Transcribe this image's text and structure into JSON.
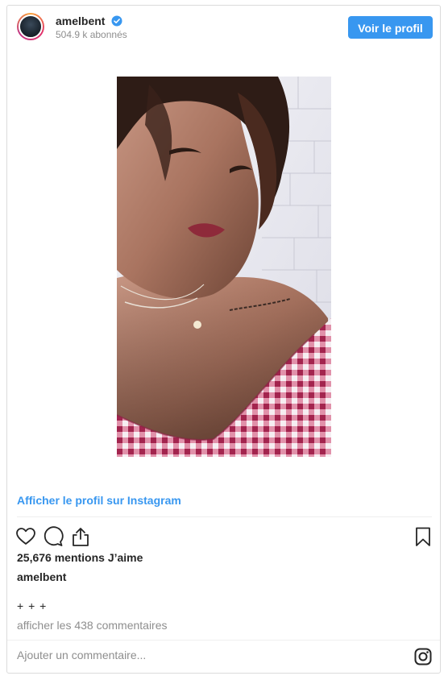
{
  "header": {
    "username": "amelbent",
    "followers": "504.9 k abonnés",
    "profile_button": "Voir le profil"
  },
  "post": {
    "view_profile_link": "Afficher le profil sur Instagram",
    "likes": "25,676 mentions J’aime",
    "owner": "amelbent",
    "caption": "+ + +",
    "view_comments": "afficher les 438 commentaires",
    "comment_placeholder": "Ajouter un commentaire..."
  },
  "icons": {
    "verified": "verified-badge-icon",
    "like": "heart-icon",
    "comment": "comment-bubble-icon",
    "share": "share-icon",
    "save": "bookmark-icon",
    "brand": "instagram-icon"
  },
  "colors": {
    "accent": "#3897f0",
    "muted_text": "#8e8e8e",
    "text": "#262626",
    "border": "#dbdbdb"
  }
}
